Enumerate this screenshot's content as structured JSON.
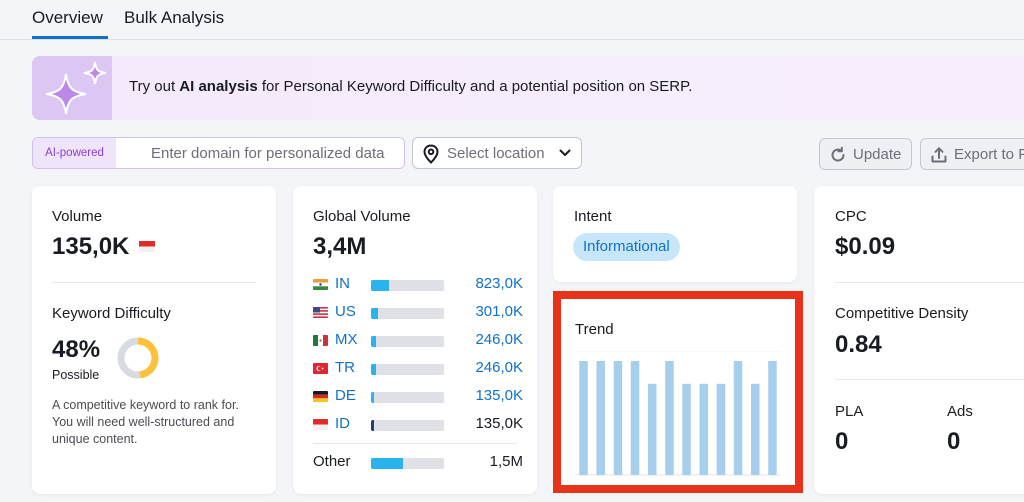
{
  "tabs": [
    {
      "label": "Overview",
      "active": true
    },
    {
      "label": "Bulk Analysis",
      "active": false
    }
  ],
  "banner": {
    "text_before": "Try out ",
    "text_bold": "AI analysis",
    "text_after": " for Personal Keyword Difficulty and a potential position on SERP."
  },
  "filters": {
    "ai_badge": "AI-powered",
    "domain_placeholder": "Enter domain for personalized data",
    "location_placeholder": "Select location",
    "update_label": "Update",
    "export_label": "Export to PDF"
  },
  "volume_card": {
    "label": "Volume",
    "value": "135,0K",
    "kd_label": "Keyword Difficulty",
    "kd_value": "48%",
    "kd_level": "Possible",
    "kd_percent": 48,
    "kd_color": "#fdc23c",
    "description": "A competitive keyword to rank for. You will need well-structured and unique content."
  },
  "global_card": {
    "label": "Global Volume",
    "value": "3,4M",
    "countries": [
      {
        "code": "IN",
        "value": "823,0K",
        "share": 0.24,
        "flag": "in"
      },
      {
        "code": "US",
        "value": "301,0K",
        "share": 0.09,
        "flag": "us"
      },
      {
        "code": "MX",
        "value": "246,0K",
        "share": 0.07,
        "flag": "mx"
      },
      {
        "code": "TR",
        "value": "246,0K",
        "share": 0.07,
        "flag": "tr"
      },
      {
        "code": "DE",
        "value": "135,0K",
        "share": 0.04,
        "flag": "de"
      },
      {
        "code": "ID",
        "value": "135,0K",
        "share": 0.04,
        "flag": "id"
      }
    ],
    "other": {
      "label": "Other",
      "value": "1,5M",
      "share": 0.44
    }
  },
  "intent_card": {
    "label": "Intent",
    "badge": "Informational"
  },
  "trend_card": {
    "label": "Trend"
  },
  "chart_data": {
    "type": "bar",
    "values": [
      1,
      1,
      1,
      1,
      0.8,
      1,
      0.8,
      0.8,
      0.8,
      1,
      0.8,
      1
    ],
    "ylim": [
      0,
      1
    ],
    "color": "#a6cfee",
    "highlight_color": "#e8321c"
  },
  "cpc_card": {
    "label": "CPC",
    "value": "$0.09",
    "density_label": "Competitive Density",
    "density_value": "0.84",
    "pla_label": "PLA",
    "pla_value": "0",
    "ads_label": "Ads",
    "ads_value": "0"
  }
}
